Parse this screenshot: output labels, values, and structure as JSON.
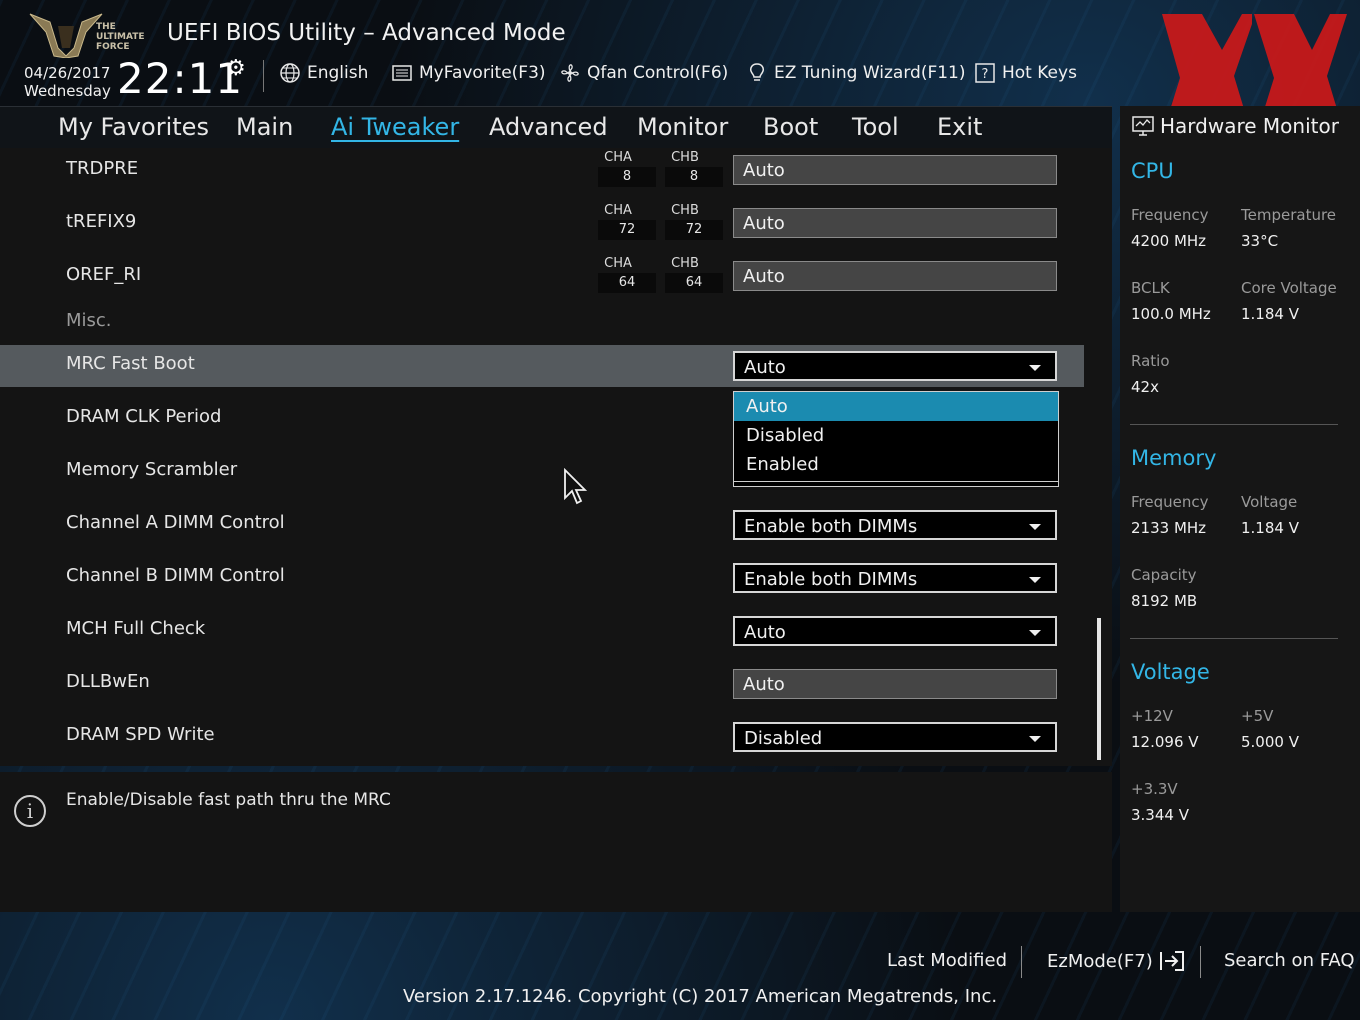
{
  "header": {
    "logo_text": [
      "THE",
      "ULTIMATE",
      "FORCE"
    ],
    "title": "UEFI BIOS Utility – Advanced Mode",
    "date": "04/26/2017",
    "day": "Wednesday",
    "time": "22:11",
    "buttons": {
      "language": "English",
      "myfavorite": "MyFavorite(F3)",
      "qfan": "Qfan Control(F6)",
      "ez_tuning": "EZ Tuning Wizard(F11)",
      "hotkeys": "Hot Keys"
    },
    "watermark_color": "#d01818"
  },
  "nav": {
    "tabs": [
      "My Favorites",
      "Main",
      "Ai Tweaker",
      "Advanced",
      "Monitor",
      "Boot",
      "Tool",
      "Exit"
    ],
    "active": "Ai Tweaker"
  },
  "settings": {
    "channel_rows": [
      {
        "label": "TRDPRE",
        "cha_head": "CHA",
        "cha": "8",
        "chb_head": "CHB",
        "chb": "8",
        "value": "Auto"
      },
      {
        "label": "tREFIX9",
        "cha_head": "CHA",
        "cha": "72",
        "chb_head": "CHB",
        "chb": "72",
        "value": "Auto"
      },
      {
        "label": "OREF_RI",
        "cha_head": "CHA",
        "cha": "64",
        "chb_head": "CHB",
        "chb": "64",
        "value": "Auto"
      }
    ],
    "misc_header": "Misc.",
    "mrc_fast_boot": {
      "label": "MRC Fast Boot",
      "value": "Auto"
    },
    "dram_clk_period": {
      "label": "DRAM CLK Period"
    },
    "memory_scrambler": {
      "label": "Memory Scrambler"
    },
    "dropdown_options": [
      "Auto",
      "Disabled",
      "Enabled"
    ],
    "dropdown_selected": "Auto",
    "channel_a_dimm": {
      "label": "Channel A DIMM Control",
      "value": "Enable both DIMMs"
    },
    "channel_b_dimm": {
      "label": "Channel B DIMM Control",
      "value": "Enable both DIMMs"
    },
    "mch_full_check": {
      "label": "MCH Full Check",
      "value": "Auto"
    },
    "dllbwen": {
      "label": "DLLBwEn",
      "value": "Auto"
    },
    "dram_spd_write": {
      "label": "DRAM SPD Write",
      "value": "Disabled"
    }
  },
  "help": {
    "text": "Enable/Disable fast path thru the MRC"
  },
  "hardware_monitor": {
    "title": "Hardware Monitor",
    "cpu": {
      "title": "CPU",
      "frequency_label": "Frequency",
      "frequency": "4200 MHz",
      "temperature_label": "Temperature",
      "temperature": "33°C",
      "bclk_label": "BCLK",
      "bclk": "100.0 MHz",
      "core_voltage_label": "Core Voltage",
      "core_voltage": "1.184 V",
      "ratio_label": "Ratio",
      "ratio": "42x"
    },
    "memory": {
      "title": "Memory",
      "frequency_label": "Frequency",
      "frequency": "2133 MHz",
      "voltage_label": "Voltage",
      "voltage": "1.184 V",
      "capacity_label": "Capacity",
      "capacity": "8192 MB"
    },
    "voltage": {
      "title": "Voltage",
      "v12_label": "+12V",
      "v12": "12.096 V",
      "v5_label": "+5V",
      "v5": "5.000 V",
      "v33_label": "+3.3V",
      "v33": "3.344 V"
    }
  },
  "footer": {
    "last_modified": "Last Modified",
    "ezmode": "EzMode(F7)",
    "search_faq": "Search on FAQ",
    "version": "Version 2.17.1246. Copyright (C) 2017 American Megatrends, Inc."
  }
}
